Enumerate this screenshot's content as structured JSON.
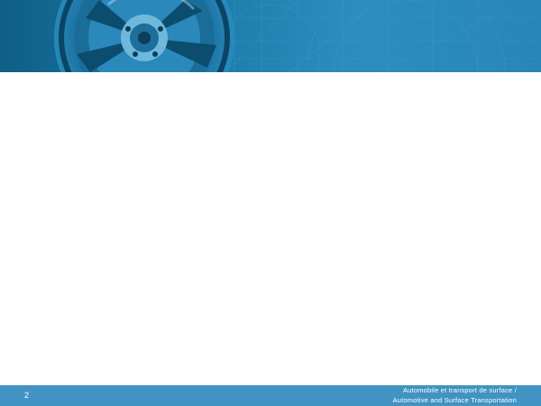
{
  "slide": {
    "page_number": "2",
    "footer": {
      "line1": "Automobile et transport de surface /",
      "line2": "Automotive and Surface Transportation"
    }
  },
  "colors": {
    "banner_dark": "#0f5f86",
    "banner_light": "#2b8dbf",
    "footer_bar": "#4093c2",
    "background": "#ffffff"
  },
  "icons": {
    "banner_image": "wheel-rim-and-blueprint-graphic"
  }
}
